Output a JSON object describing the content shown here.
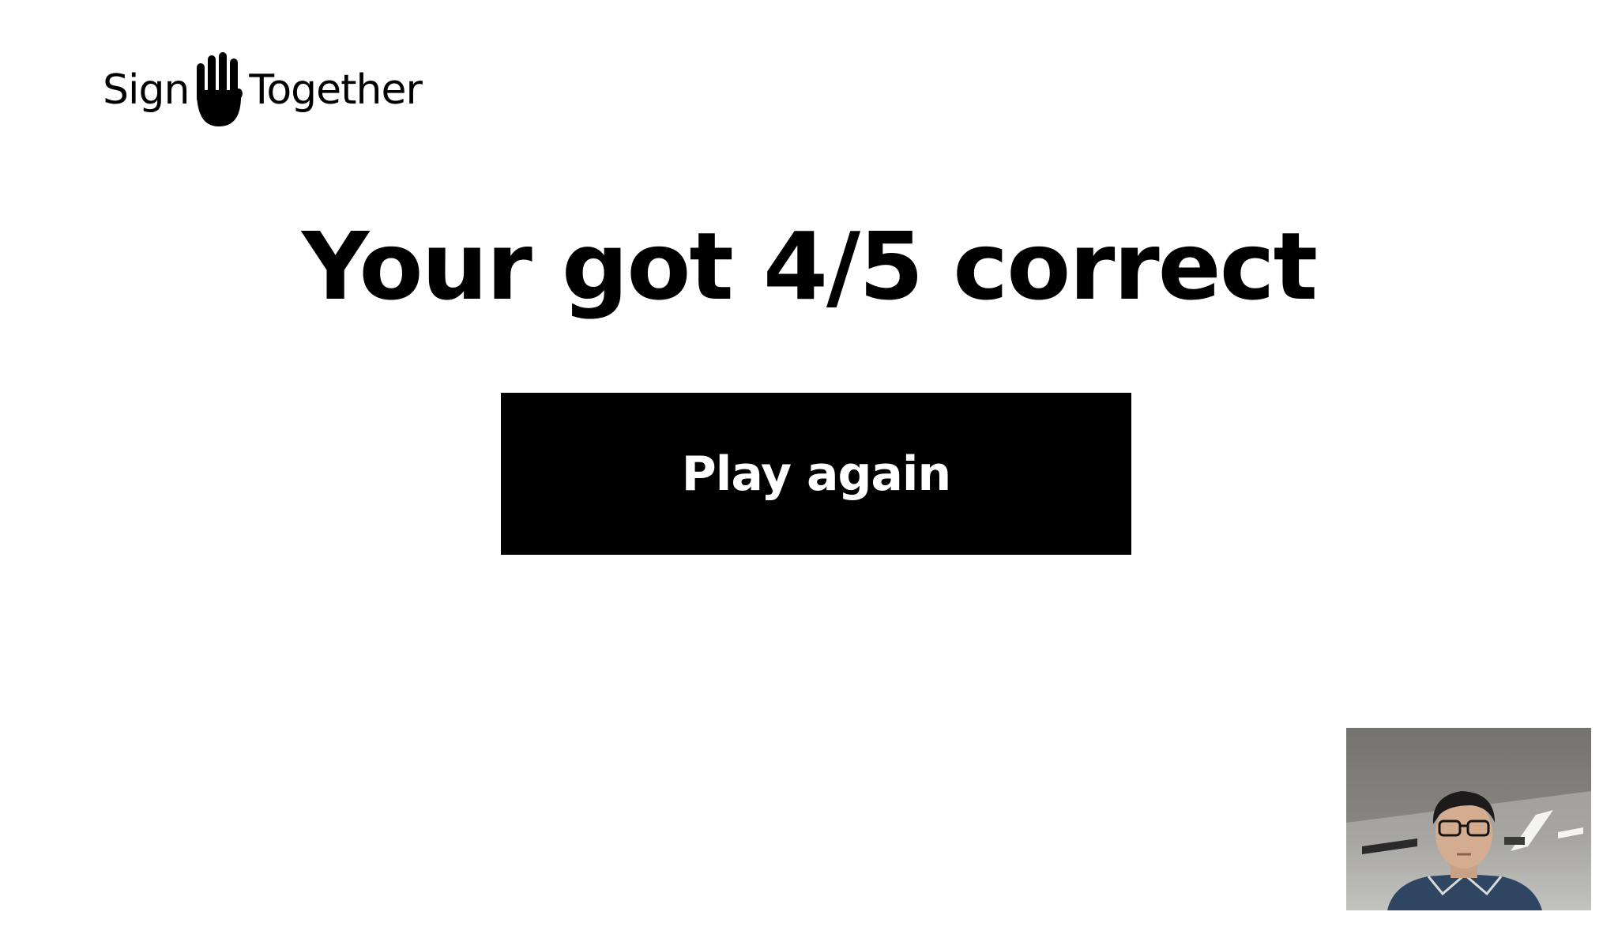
{
  "brand": {
    "word_left": "Sign",
    "word_right": "Together",
    "icon": "raised-hand-icon"
  },
  "result": {
    "message": "Your got 4/5 correct",
    "correct": 4,
    "total": 5
  },
  "actions": {
    "play_again_label": "Play again"
  },
  "webcam": {
    "icon": "webcam-preview"
  },
  "colors": {
    "background": "#ffffff",
    "text": "#000000",
    "button_background": "#000000",
    "button_text": "#ffffff"
  }
}
